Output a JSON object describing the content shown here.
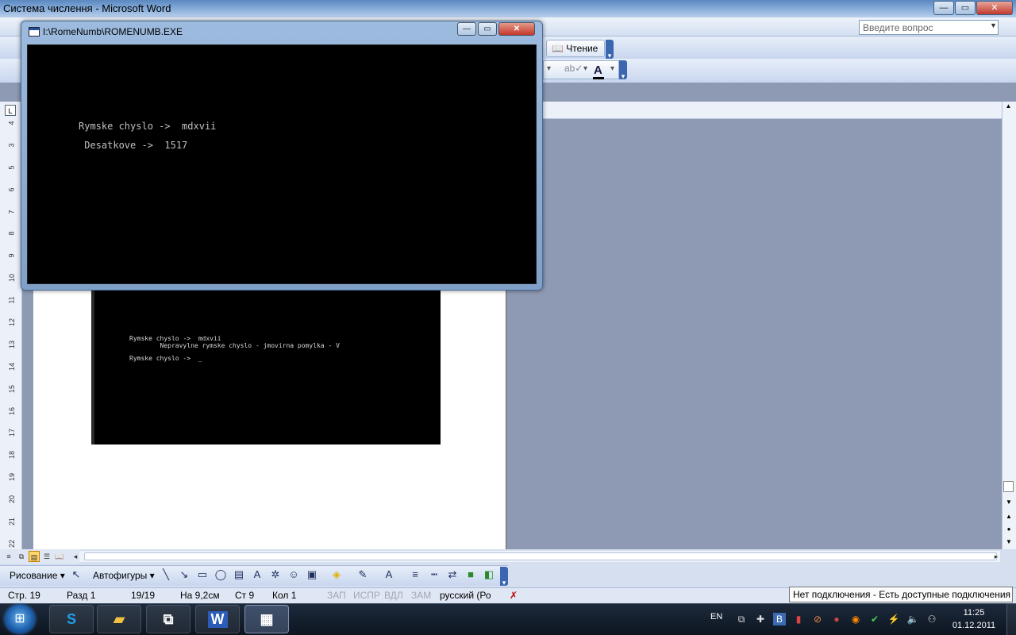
{
  "word": {
    "title": "Система числення - Microsoft Word",
    "help_placeholder": "Введите вопрос",
    "reading_button": "Чтение",
    "font_color_icon": "A"
  },
  "console": {
    "title": "I:\\RomeNumb\\ROMENUMB.EXE",
    "lines": [
      "Rymske chyslo ->  mdxvii",
      " Desatkove ->  1517"
    ]
  },
  "document": {
    "ruler_numbers": [
      "4",
      "3",
      "5",
      "6",
      "7",
      "8",
      "9",
      "10",
      "11",
      "12",
      "13",
      "14",
      "15",
      "16",
      "17",
      "18",
      "19",
      "20",
      "21",
      "22"
    ],
    "embedded_console_lines": [
      "Rymske chyslo ->  mdxvii",
      "        Nepravylne rymske chyslo - jmovirna pomylka - V",
      "",
      "Rymske chyslo ->  _"
    ]
  },
  "drawing_toolbar": {
    "drawing_label": "Рисование",
    "autoshapes_label": "Автофигуры"
  },
  "statusbar": {
    "page": "Стр. 19",
    "section": "Разд 1",
    "page_of": "19/19",
    "at": "На 9,2см",
    "line": "Ст 9",
    "column": "Кол 1",
    "rec": "ЗАП",
    "trk": "ИСПР",
    "ext": "ВДЛ",
    "ovr": "ЗАМ",
    "language": "русский (Ро",
    "network_tooltip": "Нет подключения - Есть доступные подключения"
  },
  "taskbar": {
    "language": "EN",
    "time": "11:25",
    "date": "01.12.2011",
    "word_glyph": "W"
  }
}
